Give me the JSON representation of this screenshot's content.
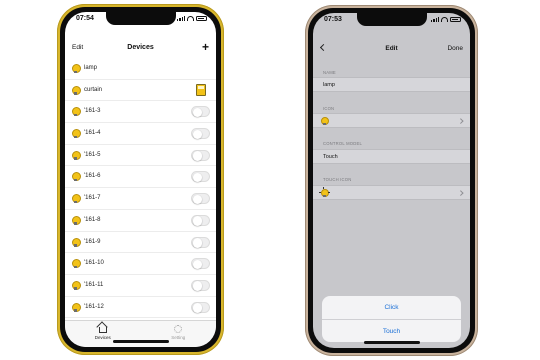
{
  "left_phone": {
    "status": {
      "time": "07:54"
    },
    "navbar": {
      "edit_label": "Edit",
      "title": "Devices",
      "add_label": "+"
    },
    "devices": [
      {
        "name": "lamp",
        "control": "none"
      },
      {
        "name": "curtain",
        "control": "icon"
      },
      {
        "name": "'161-3",
        "control": "toggle",
        "on": false
      },
      {
        "name": "'161-4",
        "control": "toggle",
        "on": false
      },
      {
        "name": "'161-5",
        "control": "toggle",
        "on": false
      },
      {
        "name": "'161-6",
        "control": "toggle",
        "on": false
      },
      {
        "name": "'161-7",
        "control": "toggle",
        "on": false
      },
      {
        "name": "'161-8",
        "control": "toggle",
        "on": false
      },
      {
        "name": "'161-9",
        "control": "toggle",
        "on": false
      },
      {
        "name": "'161-10",
        "control": "toggle",
        "on": false
      },
      {
        "name": "'161-11",
        "control": "toggle",
        "on": false
      },
      {
        "name": "'161-12",
        "control": "toggle",
        "on": false
      }
    ],
    "tabbar": {
      "devices_label": "Devices",
      "setting_label": "Setting"
    }
  },
  "right_phone": {
    "status": {
      "time": "07:53"
    },
    "navbar": {
      "title": "Edit",
      "done_label": "Done"
    },
    "form": {
      "name_header": "NAME",
      "name_value": "lamp",
      "icon_header": "ICON",
      "control_model_header": "CONTROL MODEL",
      "control_model_value": "Touch",
      "touch_icon_header": "TOUCH ICON"
    },
    "action_sheet": {
      "click_label": "Click",
      "touch_label": "Touch"
    }
  },
  "colors": {
    "left_frame": "#d8b62c",
    "right_frame": "#c9b39d",
    "bulb_yellow": "#f2c218",
    "action_blue": "#1a6fd6",
    "dim_background": "#c7c7cb"
  }
}
